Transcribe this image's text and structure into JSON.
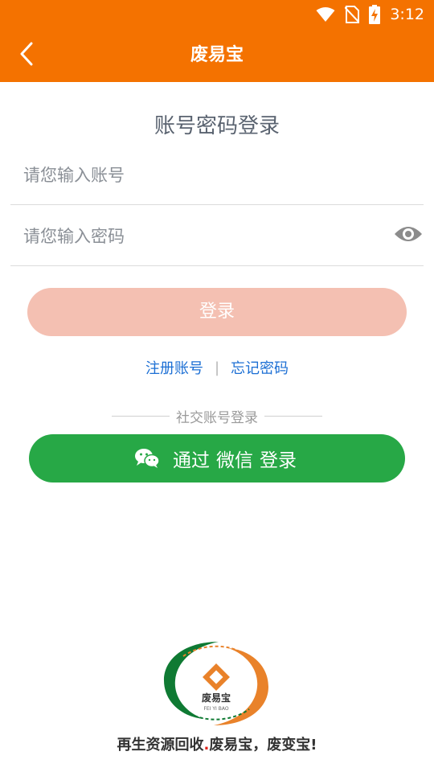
{
  "status_bar": {
    "time": "3:12",
    "icons": [
      "wifi-icon",
      "no-sim-icon",
      "battery-charging-icon"
    ]
  },
  "toolbar": {
    "back_icon": "chevron-left-icon",
    "title": "废易宝"
  },
  "login": {
    "heading": "账号密码登录",
    "account_placeholder": "请您输入账号",
    "account_value": "",
    "password_placeholder": "请您输入密码",
    "password_value": "",
    "password_toggle_icon": "eye-icon",
    "submit_label": "登录"
  },
  "links": {
    "register": "注册账号",
    "separator": "|",
    "forgot": "忘记密码"
  },
  "social": {
    "divider_label": "社交账号登录",
    "wechat_icon": "wechat-icon",
    "wechat_words": [
      "通过",
      "微信",
      "登录"
    ]
  },
  "footer": {
    "logo_name": "废易宝",
    "logo_pinyin": "FEI YI BAO",
    "slogan_part1": "再生资源回收",
    "slogan_dot": ".",
    "slogan_part2": "废易宝，废变宝!"
  },
  "colors": {
    "primary": "#f47200",
    "login_button_disabled": "#f4c0b2",
    "link": "#1c6fd4",
    "wechat": "#27a846"
  }
}
